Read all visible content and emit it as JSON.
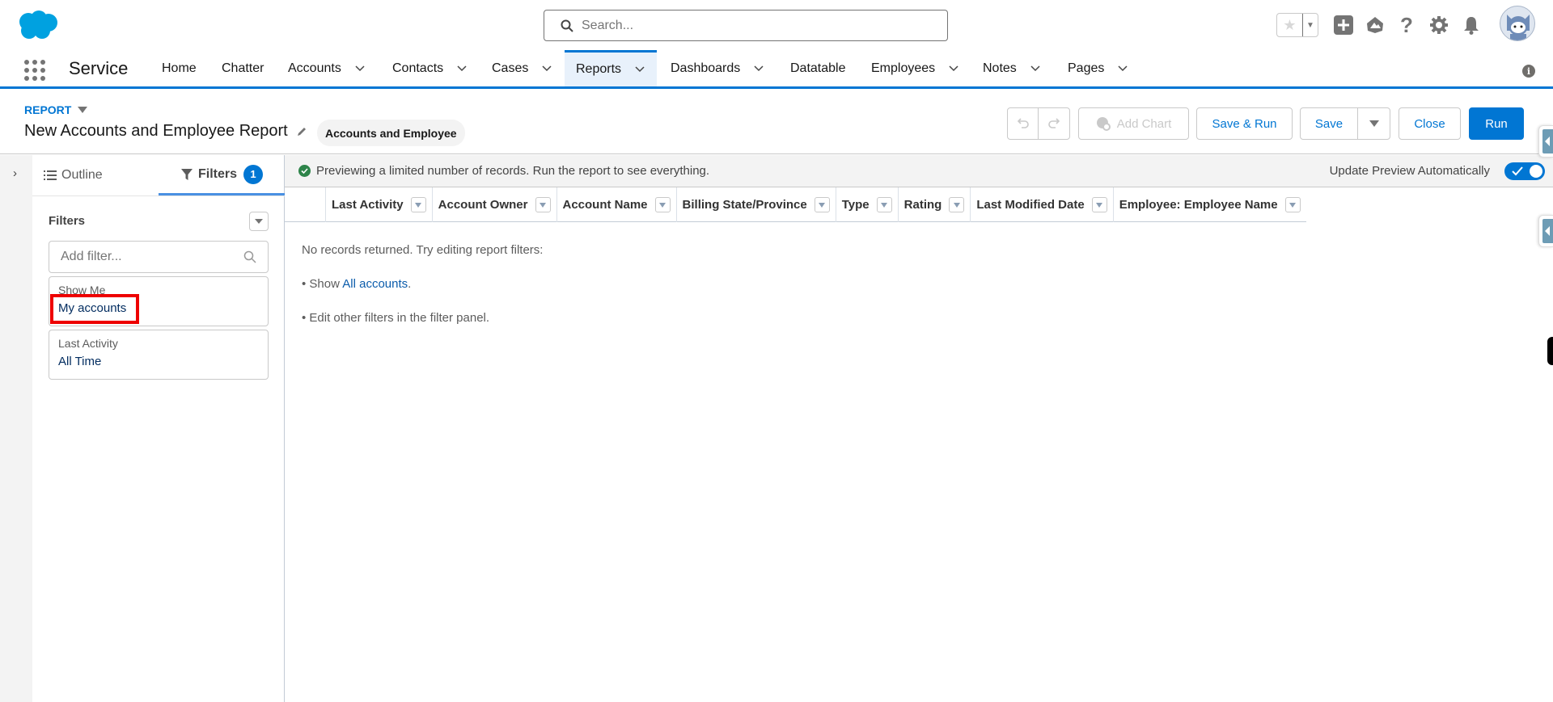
{
  "header": {
    "search_placeholder": "Search...",
    "icons": [
      "favorites-star-icon",
      "favorites-dropdown-icon",
      "global-actions-add-icon",
      "trailhead-icon",
      "help-icon",
      "setup-gear-icon",
      "notifications-bell-icon",
      "user-avatar"
    ]
  },
  "nav": {
    "app_name": "Service",
    "items": [
      {
        "label": "Home",
        "has_menu": false
      },
      {
        "label": "Chatter",
        "has_menu": false
      },
      {
        "label": "Accounts",
        "has_menu": true
      },
      {
        "label": "Contacts",
        "has_menu": true
      },
      {
        "label": "Cases",
        "has_menu": true
      },
      {
        "label": "Reports",
        "has_menu": true,
        "active": true
      },
      {
        "label": "Dashboards",
        "has_menu": true
      },
      {
        "label": "Datatable",
        "has_menu": false
      },
      {
        "label": "Employees",
        "has_menu": true
      },
      {
        "label": "Notes",
        "has_menu": true
      },
      {
        "label": "Pages",
        "has_menu": true
      }
    ]
  },
  "report": {
    "object_label": "REPORT",
    "title": "New Accounts and Employee Report",
    "report_type": "Accounts and Employee",
    "buttons": {
      "add_chart": "Add Chart",
      "save_and_run": "Save & Run",
      "save": "Save",
      "close": "Close",
      "run": "Run"
    }
  },
  "panel": {
    "tabs": {
      "outline": "Outline",
      "filters": "Filters",
      "filters_count": "1"
    },
    "filters_heading": "Filters",
    "add_filter_placeholder": "Add filter...",
    "filters": [
      {
        "label": "Show Me",
        "value": "My accounts"
      },
      {
        "label": "Last Activity",
        "value": "All Time"
      }
    ]
  },
  "preview": {
    "message": "Previewing a limited number of records. Run the report to see everything.",
    "auto_update_label": "Update Preview Automatically",
    "auto_update_on": true,
    "columns": [
      "Last Activity",
      "Account Owner",
      "Account Name",
      "Billing State/Province",
      "Type",
      "Rating",
      "Last Modified Date",
      "Employee: Employee Name"
    ],
    "empty": {
      "line1": "No records returned. Try editing report filters:",
      "line2_prefix": "• Show ",
      "line2_link": "All accounts",
      "line2_suffix": ".",
      "line3": "• Edit other filters in the filter panel."
    }
  },
  "colors": {
    "brand": "#0176d3",
    "success": "#2e844a",
    "highlight": "#ee0000"
  }
}
